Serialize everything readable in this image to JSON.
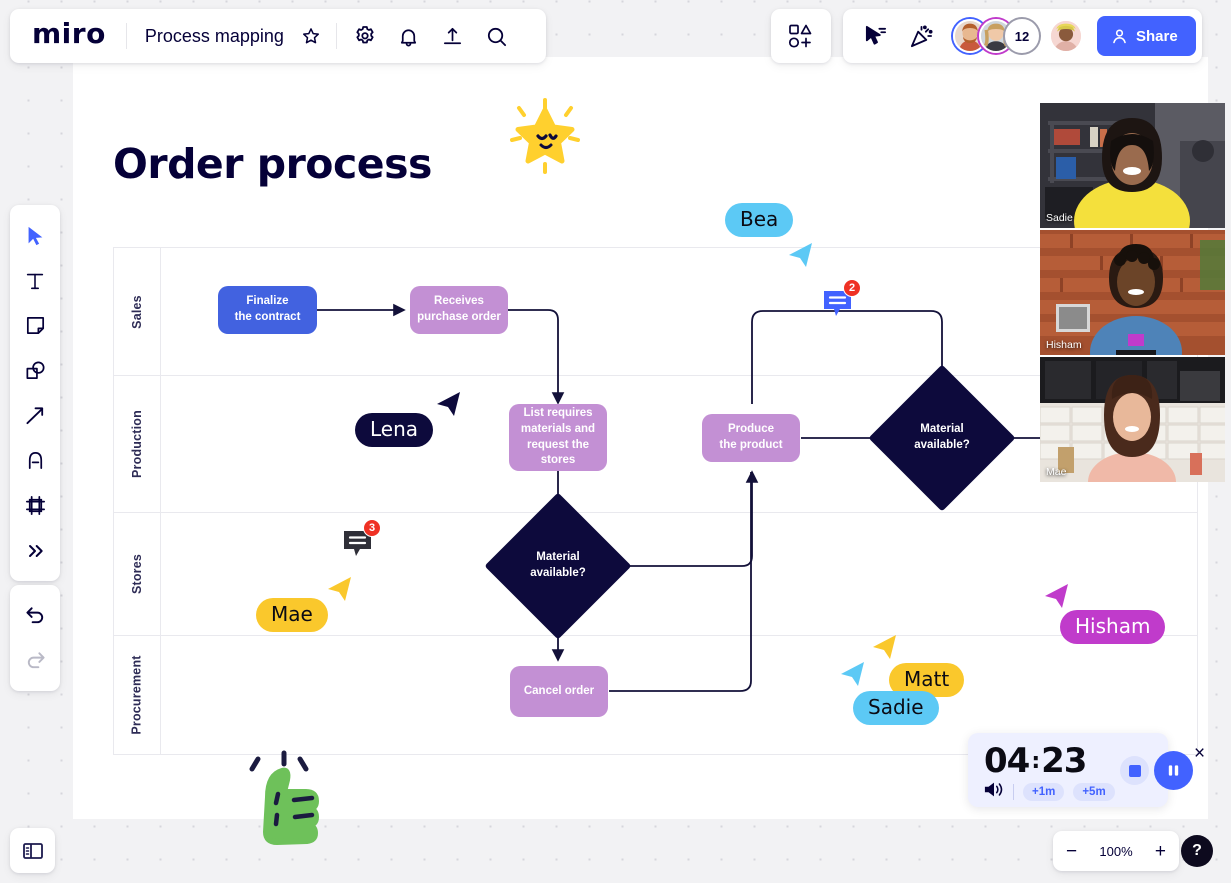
{
  "app": {
    "name": "miro",
    "board_title": "Process mapping"
  },
  "topbar": {
    "icons": [
      {
        "name": "star-icon",
        "label": "Favorite"
      },
      {
        "name": "gear-icon",
        "label": "Settings"
      },
      {
        "name": "bell-icon",
        "label": "Notifications"
      },
      {
        "name": "upload-icon",
        "label": "Upload"
      },
      {
        "name": "search-icon",
        "label": "Search"
      }
    ],
    "apps_icon": "shapes-plus-icon",
    "cursor_chat_icon": "cursor-chat-icon",
    "celebrate_icon": "party-popper-icon",
    "collaborator_count": "12",
    "share_label": "Share"
  },
  "left_toolbar": {
    "items": [
      {
        "name": "select-tool",
        "label": "Select"
      },
      {
        "name": "text-tool",
        "label": "Text"
      },
      {
        "name": "sticky-note-tool",
        "label": "Sticky note"
      },
      {
        "name": "shapes-tool",
        "label": "Shapes"
      },
      {
        "name": "connection-line-tool",
        "label": "Connection line"
      },
      {
        "name": "pen-tool",
        "label": "Pen"
      },
      {
        "name": "frame-tool",
        "label": "Frame"
      },
      {
        "name": "more-tools",
        "label": "More tools"
      }
    ],
    "undo_label": "Undo",
    "redo_label": "Redo",
    "panel_toggle_label": "Toggle panel"
  },
  "board": {
    "heading": "Order process",
    "lanes": [
      {
        "label": "Sales"
      },
      {
        "label": "Production"
      },
      {
        "label": "Stores"
      },
      {
        "label": "Procurement"
      }
    ],
    "nodes": [
      {
        "id": "finalize",
        "text": "Finalize\nthe contract",
        "shape": "rect",
        "color": "#4262e0"
      },
      {
        "id": "receives",
        "text": "Receives\npurchase order",
        "shape": "rect",
        "color": "#c390d4"
      },
      {
        "id": "list",
        "text": "List requires\nmaterials and\nrequest the stores",
        "shape": "rect",
        "color": "#c390d4"
      },
      {
        "id": "produce",
        "text": "Produce\nthe product",
        "shape": "rect",
        "color": "#c390d4"
      },
      {
        "id": "mat1",
        "text": "Material\navailable?",
        "shape": "diamond",
        "color": "#0d0a3c"
      },
      {
        "id": "mat2",
        "text": "Material\navailable?",
        "shape": "diamond",
        "color": "#0d0a3c"
      },
      {
        "id": "cancel",
        "text": "Cancel order",
        "shape": "rect",
        "color": "#c390d4"
      }
    ],
    "node_labels": {
      "finalize_l1": "Finalize",
      "finalize_l2": "the contract",
      "receives_l1": "Receives",
      "receives_l2": "purchase order",
      "list_l1": "List requires",
      "list_l2": "materials and",
      "list_l3": "request the stores",
      "produce_l1": "Produce",
      "produce_l2": "the product",
      "mat_l1": "Material",
      "mat_l2": "available?",
      "cancel_l1": "Cancel order"
    },
    "stickers": [
      {
        "name": "star-sticker",
        "label": "Smiling star"
      },
      {
        "name": "thumbs-up-sticker",
        "label": "Thumbs up"
      }
    ]
  },
  "cursors": [
    {
      "name": "Bea",
      "color": "#5cc9f5",
      "text_color": "#0b0b14"
    },
    {
      "name": "Lena",
      "color": "#0d0a3c",
      "text_color": "#ffffff"
    },
    {
      "name": "Mae",
      "color": "#fac82c",
      "text_color": "#0b0b14"
    },
    {
      "name": "Matt",
      "color": "#fac82c",
      "text_color": "#0b0b14"
    },
    {
      "name": "Sadie",
      "color": "#5cc9f5",
      "text_color": "#0b0b14"
    },
    {
      "name": "Hisham",
      "color": "#c03bcb",
      "text_color": "#ffffff"
    }
  ],
  "comments": [
    {
      "name": "comment-pin-sales",
      "count": "2",
      "color": "#4262ff"
    },
    {
      "name": "comment-pin-stores",
      "count": "3",
      "color": "#2f2f38"
    }
  ],
  "video_panel": {
    "tiles": [
      {
        "name": "Sadie"
      },
      {
        "name": "Hisham"
      },
      {
        "name": "Mae"
      }
    ]
  },
  "timer": {
    "minutes": "04",
    "separator": ":",
    "seconds": "23",
    "add_1m": "+1m",
    "add_5m": "+5m",
    "volume_icon": "volume-icon",
    "stop_label": "Stop",
    "pause_label": "Pause",
    "close_label": "×"
  },
  "zoom": {
    "minus": "−",
    "level": "100%",
    "plus": "+",
    "help": "?"
  }
}
